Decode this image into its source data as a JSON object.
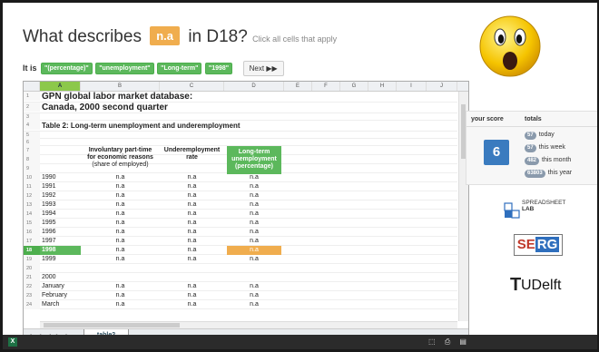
{
  "question": {
    "prefix": "What describes",
    "chip": "n.a",
    "suffix": "in D18?",
    "hint": "Click all cells that apply"
  },
  "it_is": {
    "label": "It is",
    "tags": [
      "\"(percentage)\"",
      "\"unemployment\"",
      "\"Long-term\"",
      "\"1998\""
    ],
    "next_label": "Next ▶▶"
  },
  "sheet": {
    "columns": [
      "A",
      "B",
      "C",
      "D",
      "E",
      "F",
      "G",
      "H",
      "I",
      "J"
    ],
    "title1": "GPN global labor market database:",
    "title2": "Canada, 2000 second quarter",
    "table_title": "Table 2: Long-term unemployment and underemployment",
    "col_b_header": [
      "Involuntary part-time",
      "for economic reasons",
      "(share of employed)"
    ],
    "col_c_header": [
      "Underemployment",
      "rate"
    ],
    "col_d_header": [
      "Long-term",
      "unemployment",
      "(percentage)"
    ],
    "rows": [
      {
        "n": "10",
        "a": "1990",
        "b": "n.a",
        "c": "n.a",
        "d": "n.a"
      },
      {
        "n": "11",
        "a": "1991",
        "b": "n.a",
        "c": "n.a",
        "d": "n.a"
      },
      {
        "n": "12",
        "a": "1992",
        "b": "n.a",
        "c": "n.a",
        "d": "n.a"
      },
      {
        "n": "13",
        "a": "1993",
        "b": "n.a",
        "c": "n.a",
        "d": "n.a"
      },
      {
        "n": "14",
        "a": "1994",
        "b": "n.a",
        "c": "n.a",
        "d": "n.a"
      },
      {
        "n": "15",
        "a": "1995",
        "b": "n.a",
        "c": "n.a",
        "d": "n.a"
      },
      {
        "n": "16",
        "a": "1996",
        "b": "n.a",
        "c": "n.a",
        "d": "n.a"
      },
      {
        "n": "17",
        "a": "1997",
        "b": "n.a",
        "c": "n.a",
        "d": "n.a"
      },
      {
        "n": "18",
        "a": "1998",
        "b": "n.a",
        "c": "n.a",
        "d": "n.a"
      },
      {
        "n": "19",
        "a": "1999",
        "b": "n.a",
        "c": "n.a",
        "d": "n.a"
      },
      {
        "n": "20",
        "a": "",
        "b": "",
        "c": "",
        "d": ""
      },
      {
        "n": "21",
        "a": "2000",
        "b": "",
        "c": "",
        "d": ""
      },
      {
        "n": "22",
        "a": "January",
        "b": "n.a",
        "c": "n.a",
        "d": "n.a"
      },
      {
        "n": "23",
        "a": "February",
        "b": "n.a",
        "c": "n.a",
        "d": "n.a"
      },
      {
        "n": "24",
        "a": "March",
        "b": "n.a",
        "c": "n.a",
        "d": "n.a"
      }
    ],
    "tab_name": "table2",
    "excel_icon": "X"
  },
  "score": {
    "label": "your score",
    "value": "6",
    "totals_label": "totals",
    "totals": [
      {
        "count": "57",
        "label": "today"
      },
      {
        "count": "57",
        "label": "this week"
      },
      {
        "count": "482",
        "label": "this month"
      },
      {
        "count": "63803",
        "label": "this year"
      }
    ]
  },
  "logos": {
    "spreadsheet_lab": [
      "SPREADSHEET",
      "LAB"
    ],
    "serg": [
      "SE",
      "RG"
    ],
    "tudelft": [
      "T",
      "UDelft"
    ]
  },
  "colors": {
    "accent_orange": "#f0ad4e",
    "accent_green": "#5cb85c",
    "score_blue": "#3a7bbf"
  },
  "icons": [
    "shocked-face-icon",
    "next-arrow-icon",
    "excel-icon"
  ]
}
